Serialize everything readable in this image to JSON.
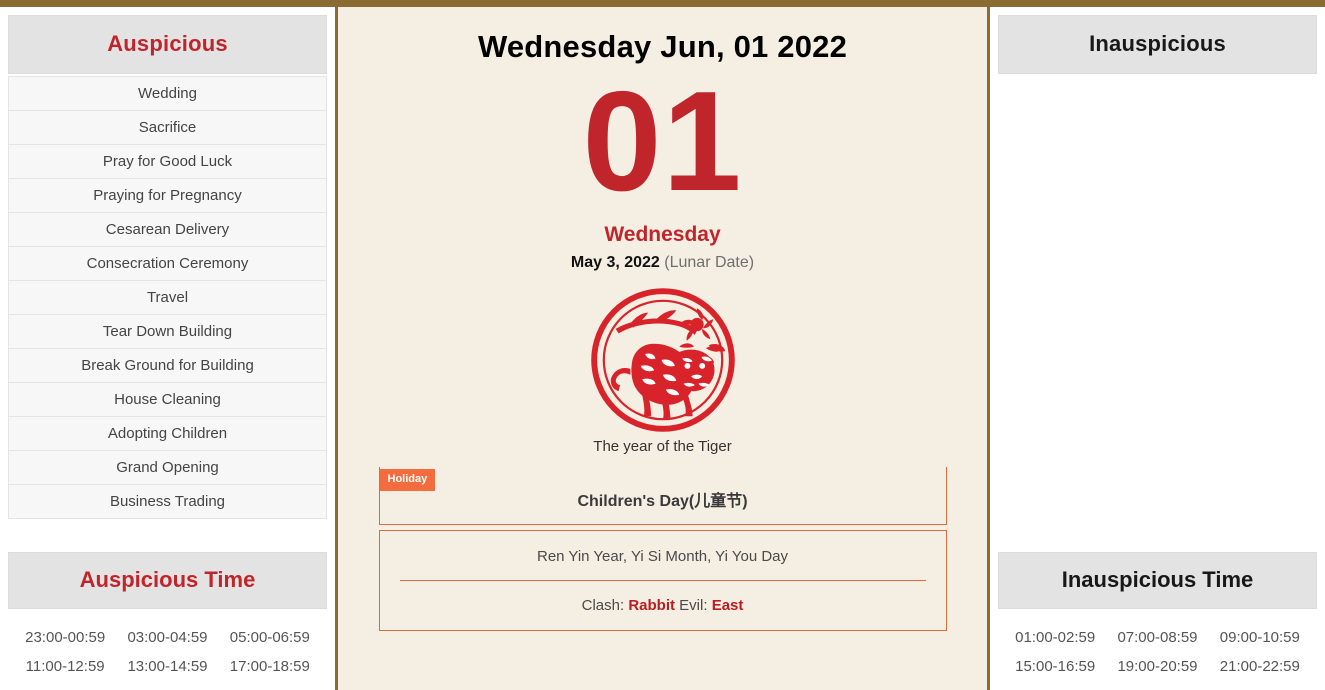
{
  "colors": {
    "frame": "#8a6b33",
    "accent_red": "#c0252b",
    "accent_orange": "#f26c3d",
    "center_bg": "#f4efe2",
    "panel_head_bg": "#e3e3e3"
  },
  "left_panel": {
    "header": "Auspicious",
    "items": [
      "Wedding",
      "Sacrifice",
      "Pray for Good Luck",
      "Praying for Pregnancy",
      "Cesarean Delivery",
      "Consecration Ceremony",
      "Travel",
      "Tear Down Building",
      "Break Ground for Building",
      "House Cleaning",
      "Adopting Children",
      "Grand Opening",
      "Business Trading"
    ],
    "time_header": "Auspicious Time",
    "times": [
      "23:00-00:59",
      "03:00-04:59",
      "05:00-06:59",
      "11:00-12:59",
      "13:00-14:59",
      "17:00-18:59"
    ]
  },
  "right_panel": {
    "header": "Inauspicious",
    "items": [],
    "time_header": "Inauspicious Time",
    "times": [
      "01:00-02:59",
      "07:00-08:59",
      "09:00-10:59",
      "15:00-16:59",
      "19:00-20:59",
      "21:00-22:59"
    ]
  },
  "center": {
    "main_date": "Wednesday Jun, 01 2022",
    "day_number": "01",
    "weekday": "Wednesday",
    "lunar_date": "May 3, 2022",
    "lunar_label": "(Lunar Date)",
    "zodiac_caption": "The year of the Tiger",
    "zodiac_icon": "tiger-papercut-icon",
    "holiday_badge": "Holiday",
    "holiday_name": "Children's Day(儿童节)",
    "ganzhi": "Ren Yin Year, Yi Si Month, Yi You Day",
    "clash_prefix": "Clash:",
    "clash_value": "Rabbit",
    "evil_prefix": "Evil:",
    "evil_value": "East"
  }
}
